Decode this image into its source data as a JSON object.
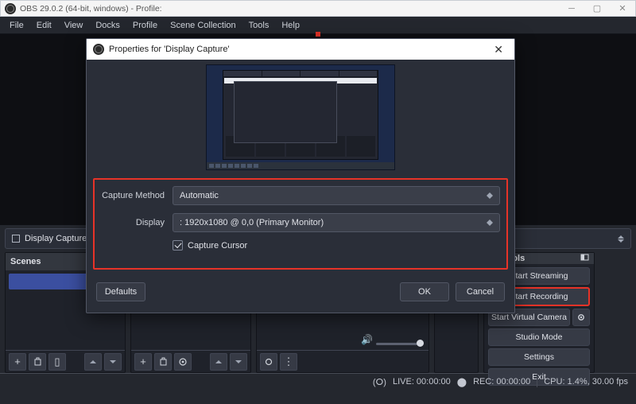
{
  "window": {
    "title": "OBS 29.0.2 (64-bit, windows) - Profile:"
  },
  "menu": [
    "File",
    "Edit",
    "View",
    "Docks",
    "Profile",
    "Scene Collection",
    "Tools",
    "Help"
  ],
  "source_label": "Display Capture",
  "panels": {
    "scenes": "Scenes",
    "controls": "Controls"
  },
  "controls": {
    "stream": "Start Streaming",
    "record": "Start Recording",
    "vcam": "Start Virtual Camera",
    "studio": "Studio Mode",
    "settings": "Settings",
    "exit": "Exit"
  },
  "status": {
    "live": "LIVE: 00:00:00",
    "rec": "REC: 00:00:00",
    "cpu": "CPU: 1.4%, 30.00 fps"
  },
  "modal": {
    "title": "Properties for 'Display Capture'",
    "capture_method_label": "Capture Method",
    "capture_method_value": "Automatic",
    "display_label": "Display",
    "display_value": ": 1920x1080 @ 0,0 (Primary Monitor)",
    "cursor_label": "Capture Cursor",
    "defaults": "Defaults",
    "ok": "OK",
    "cancel": "Cancel"
  }
}
